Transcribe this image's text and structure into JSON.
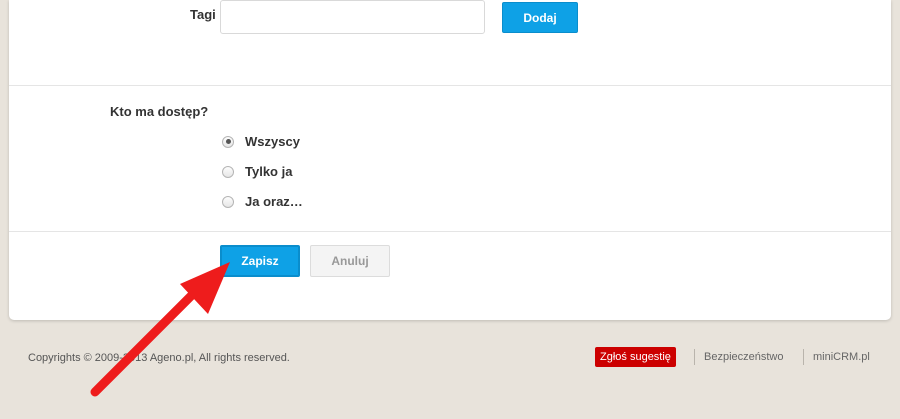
{
  "form": {
    "tags": {
      "label": "Tagi",
      "value": "",
      "add_button": "Dodaj"
    },
    "access": {
      "title": "Kto ma dostęp?",
      "options": [
        {
          "label": "Wszyscy",
          "selected": true
        },
        {
          "label": "Tylko ja",
          "selected": false
        },
        {
          "label": "Ja oraz…",
          "selected": false
        }
      ]
    },
    "save_button": "Zapisz",
    "cancel_button": "Anuluj"
  },
  "footer": {
    "copyright": "Copyrights © 2009-2013 Ageno.pl, All rights reserved.",
    "suggest_button": "Zgłoś sugestię",
    "links": [
      "Bezpieczeństwo",
      "miniCRM.pl"
    ]
  },
  "colors": {
    "primary": "#0ea1e6",
    "suggest": "#cc0000",
    "arrow": "#ee1c1c"
  }
}
